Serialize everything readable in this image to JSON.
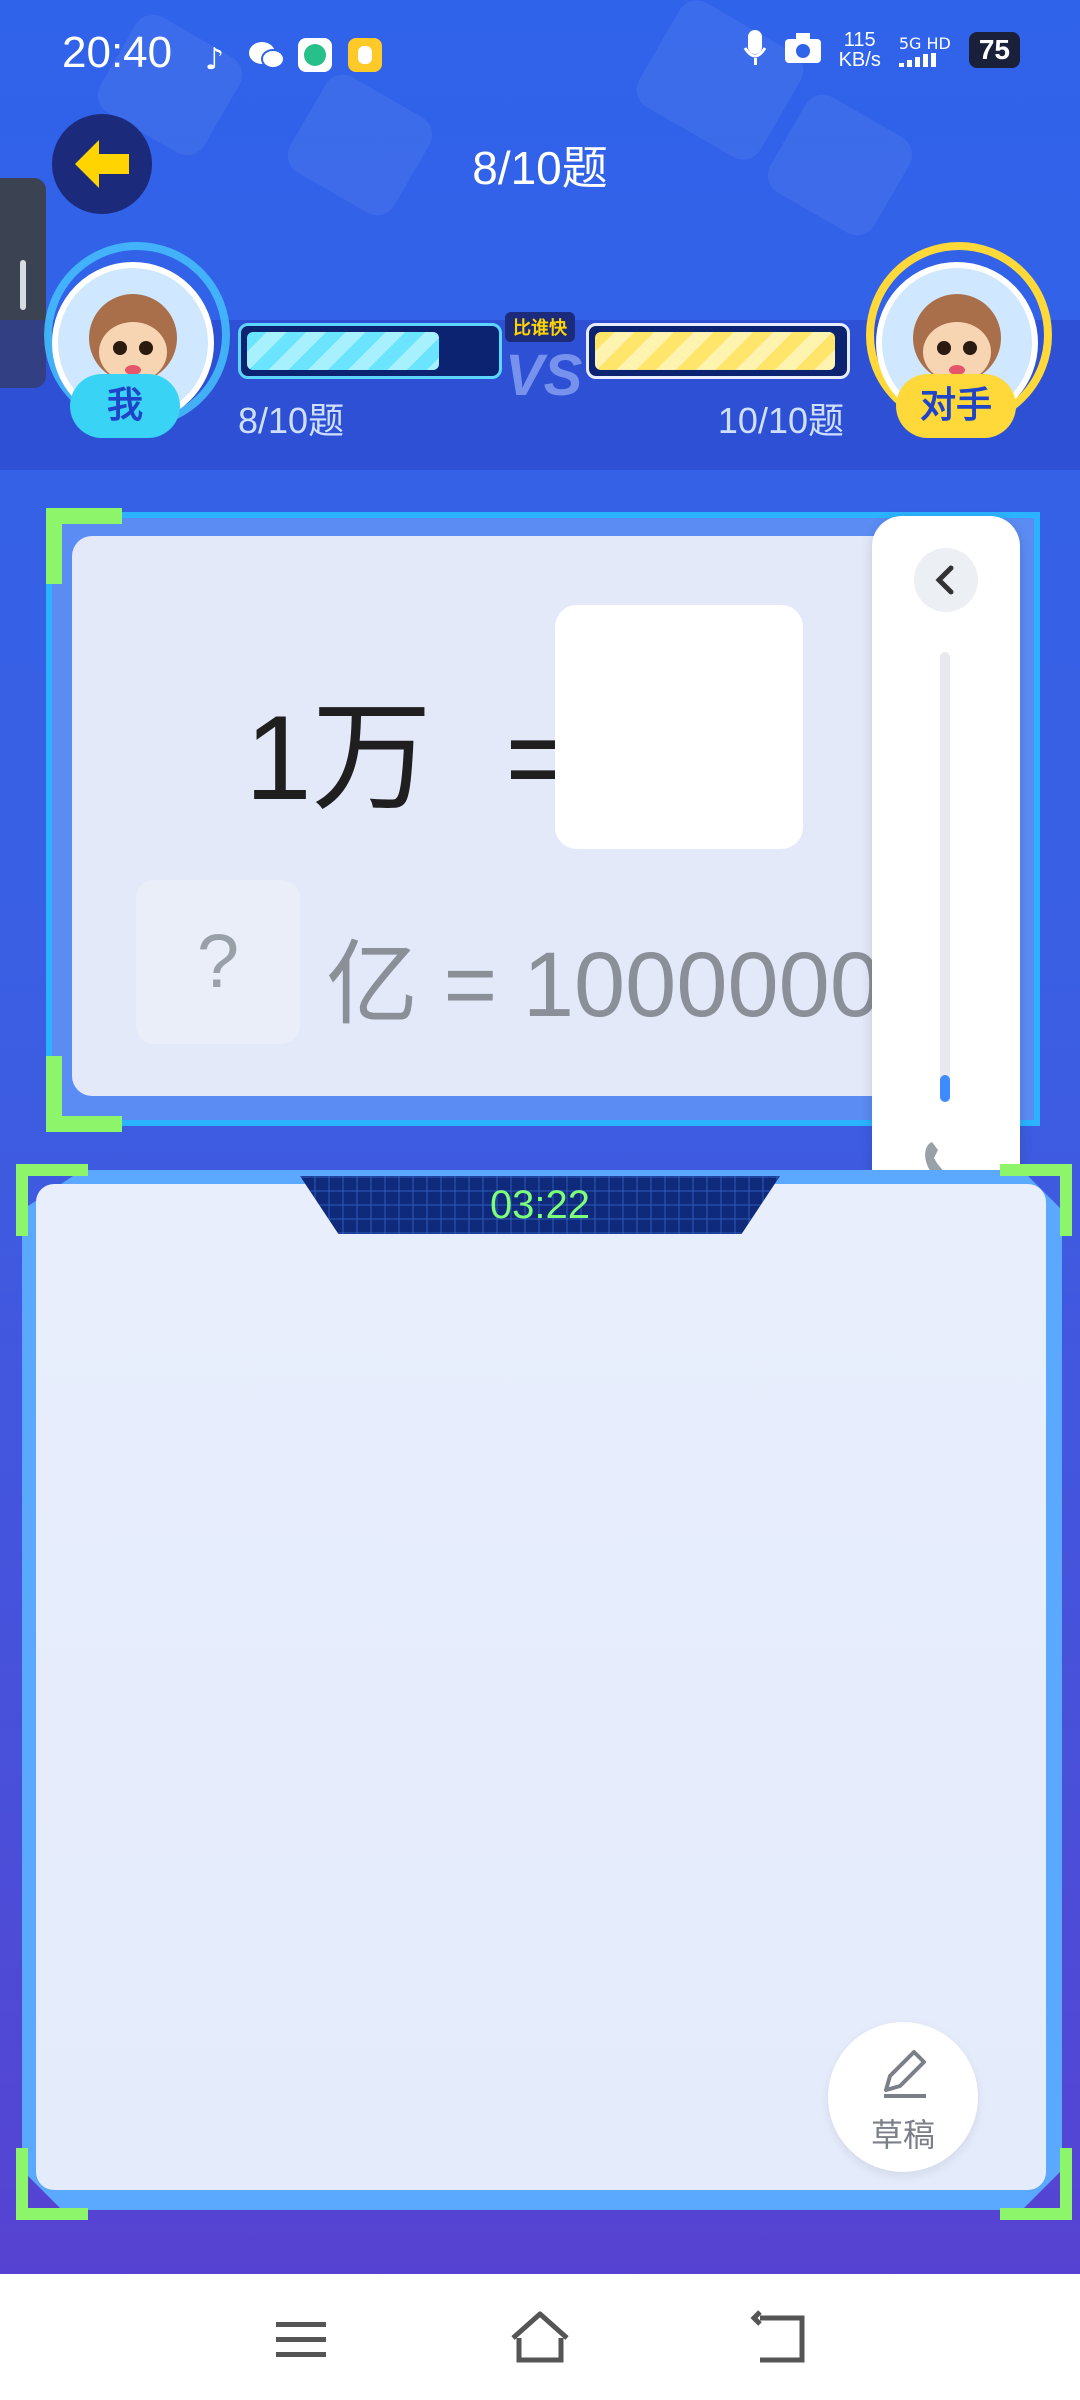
{
  "status_bar": {
    "time": "20:40",
    "net_speed_value": "115",
    "net_speed_unit": "KB/s",
    "network": "5G HD",
    "battery": "75",
    "icons": [
      "music-note-icon",
      "wechat-icon",
      "green-app-icon",
      "yellow-app-icon",
      "mic-icon",
      "camera-icon",
      "signal-icon"
    ]
  },
  "header": {
    "title": "8/10题",
    "back_icon": "arrow-left-icon"
  },
  "versus": {
    "me": {
      "tag": "我",
      "progress_text": "8/10题",
      "progress": 0.8
    },
    "opponent": {
      "tag": "对手",
      "progress_text": "10/10题",
      "progress": 1.0
    },
    "badge": "比谁快"
  },
  "question": {
    "left": "1万",
    "equals": "=",
    "answer_value": "",
    "next_placeholder": "?",
    "next_text": "亿 = 10000000"
  },
  "volume_panel": {
    "collapse_icon": "chevron-left-icon",
    "level": 0.06,
    "phone_icon": "phone-icon"
  },
  "bell_icon": "bell-icon",
  "answer_area": {
    "timer": "03:22",
    "draft_label": "草稿",
    "draft_icon": "pencil-icon"
  },
  "nav_bar": {
    "icons": [
      "menu-icon",
      "home-icon",
      "back-icon"
    ]
  },
  "colors": {
    "accent_green": "#8cf56a",
    "frame_blue": "#2bb3ff",
    "me_tag": "#39d3f5",
    "opponent_tag": "#ffd83a",
    "timer_text": "#7dff7a",
    "bell_bg": "#ffe062"
  }
}
